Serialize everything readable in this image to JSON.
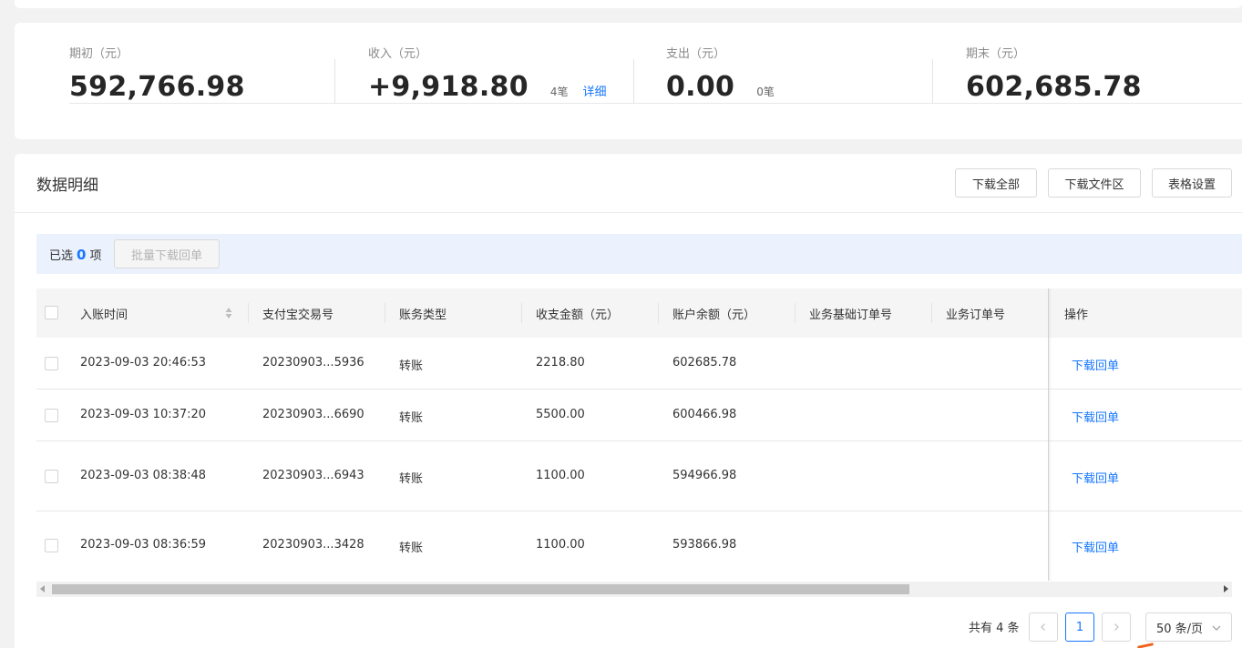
{
  "summary": {
    "opening": {
      "label": "期初（元）",
      "value": "592,766.98"
    },
    "income": {
      "label": "收入（元）",
      "value": "+9,918.80",
      "count": "4笔",
      "detail_link": "详细"
    },
    "expense": {
      "label": "支出（元）",
      "value": "0.00",
      "count": "0笔"
    },
    "closing": {
      "label": "期末（元）",
      "value": "602,685.78"
    }
  },
  "panel": {
    "title": "数据明细",
    "buttons": {
      "download_all": "下载全部",
      "download_area": "下载文件区",
      "table_settings": "表格设置"
    }
  },
  "selection": {
    "prefix": "已选",
    "count": "0",
    "suffix": "项",
    "batch_button": "批量下载回单"
  },
  "table": {
    "columns": [
      "入账时间",
      "支付宝交易号",
      "账务类型",
      "收支金额（元）",
      "账户余额（元）",
      "业务基础订单号",
      "业务订单号",
      "操作"
    ],
    "rows": [
      {
        "time": "2023-09-03 20:46:53",
        "trade_no": "20230903...5936",
        "type": "转账",
        "amount": "2218.80",
        "balance": "602685.78",
        "base_order": "",
        "order": "",
        "action": "下载回单"
      },
      {
        "time": "2023-09-03 10:37:20",
        "trade_no": "20230903...6690",
        "type": "转账",
        "amount": "5500.00",
        "balance": "600466.98",
        "base_order": "",
        "order": "",
        "action": "下载回单"
      },
      {
        "time": "2023-09-03 08:38:48",
        "trade_no": "20230903...6943",
        "type": "转账",
        "amount": "1100.00",
        "balance": "594966.98",
        "base_order": "",
        "order": "",
        "action": "下载回单"
      },
      {
        "time": "2023-09-03 08:36:59",
        "trade_no": "20230903...3428",
        "type": "转账",
        "amount": "1100.00",
        "balance": "593866.98",
        "base_order": "",
        "order": "",
        "action": "下载回单"
      }
    ]
  },
  "pagination": {
    "total": "共有 4 条",
    "current_page": "1",
    "page_size": "50 条/页"
  },
  "colors": {
    "accent": "#1677ff",
    "selection_bg": "#ebf2fd",
    "header_bg": "#f5f5f5"
  },
  "icons": [
    "sort-icon",
    "chevron-left-icon",
    "chevron-right-icon",
    "chevron-down-icon",
    "scroll-left-arrow-icon",
    "scroll-right-arrow-icon"
  ]
}
